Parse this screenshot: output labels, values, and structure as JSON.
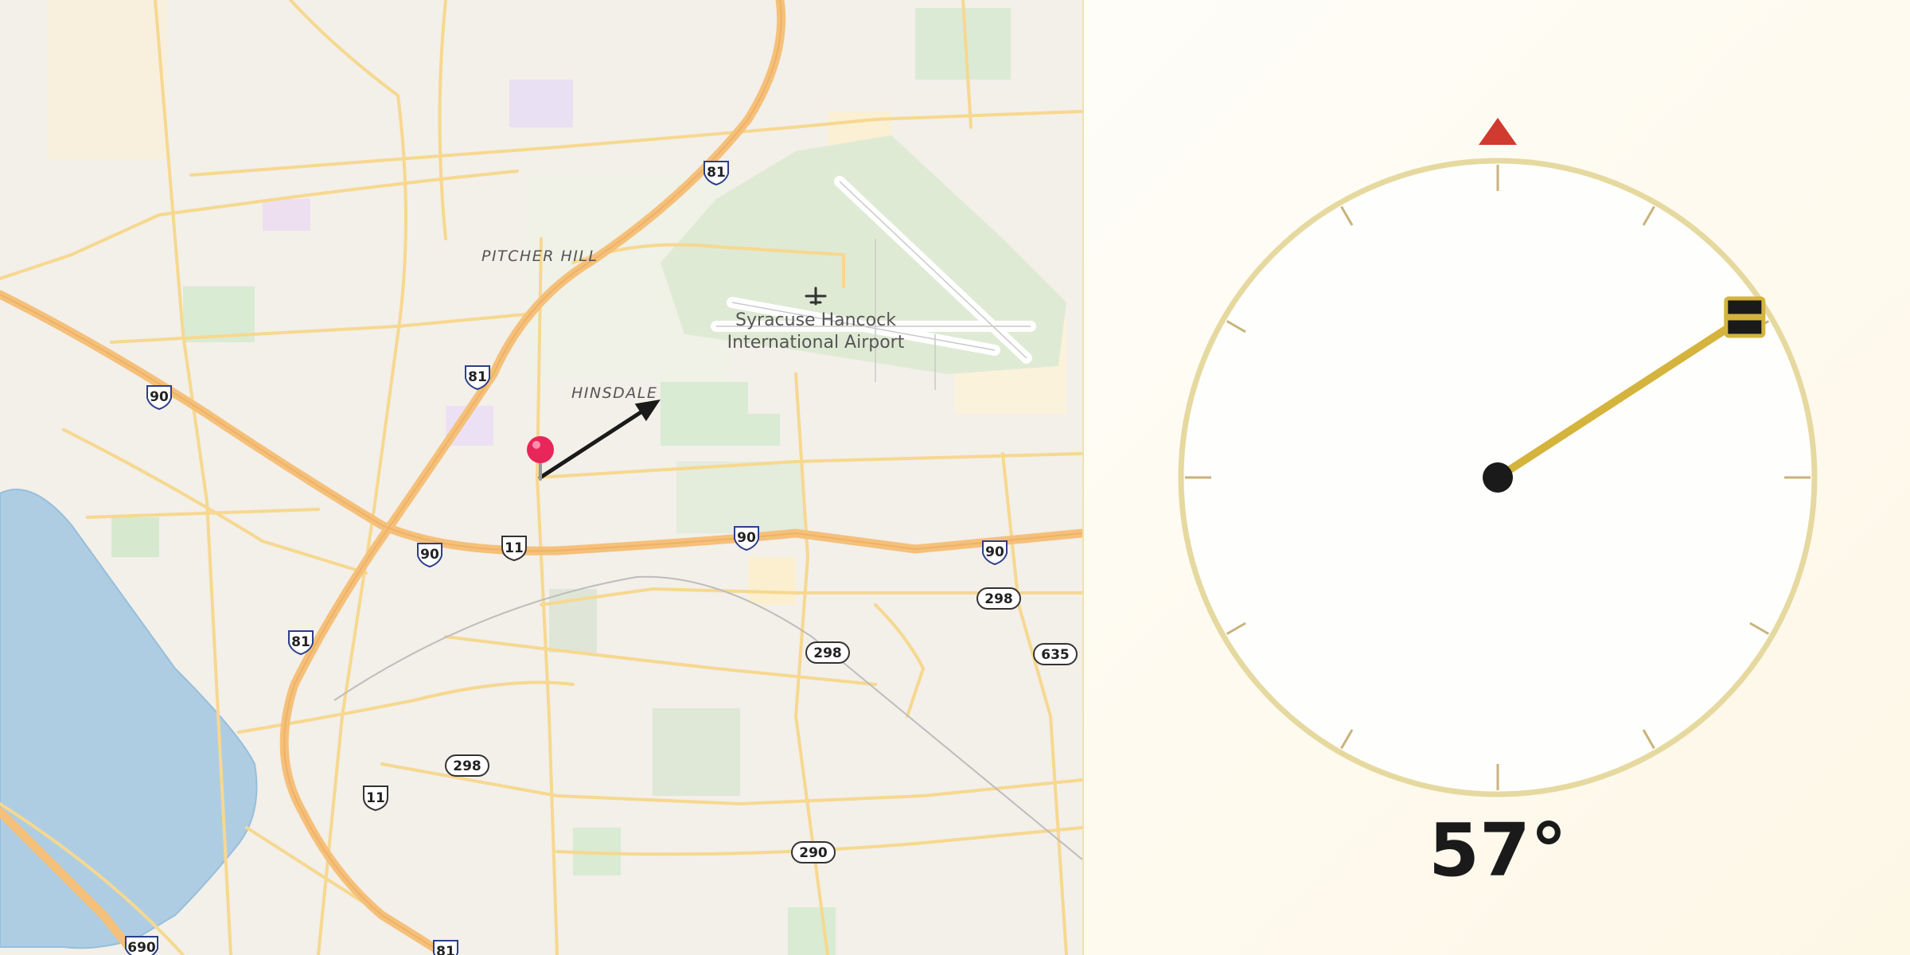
{
  "map": {
    "place_labels": [
      "PITCHER HILL",
      "HINSDALE"
    ],
    "airport_name_line1": "Syracuse Hancock",
    "airport_name_line2": "International Airport",
    "route_shields": [
      {
        "type": "interstate",
        "number": "81"
      },
      {
        "type": "interstate",
        "number": "81"
      },
      {
        "type": "interstate",
        "number": "81"
      },
      {
        "type": "interstate",
        "number": "81"
      },
      {
        "type": "interstate",
        "number": "90"
      },
      {
        "type": "interstate",
        "number": "90"
      },
      {
        "type": "interstate",
        "number": "90"
      },
      {
        "type": "interstate",
        "number": "90"
      },
      {
        "type": "interstate",
        "number": "690"
      },
      {
        "type": "us",
        "number": "11"
      },
      {
        "type": "us",
        "number": "11"
      },
      {
        "type": "state",
        "number": "298"
      },
      {
        "type": "state",
        "number": "298"
      },
      {
        "type": "state",
        "number": "298"
      },
      {
        "type": "state",
        "number": "635"
      },
      {
        "type": "state",
        "number": "290"
      }
    ],
    "pin_color": "#e8265a",
    "arrow_color": "#1a1a1a"
  },
  "compass": {
    "heading_degrees": 57,
    "heading_label": "57°",
    "needle_color": "#d4b43c",
    "north_marker_color": "#d03a2f",
    "dial_ring_color": "#e6d9a0"
  }
}
